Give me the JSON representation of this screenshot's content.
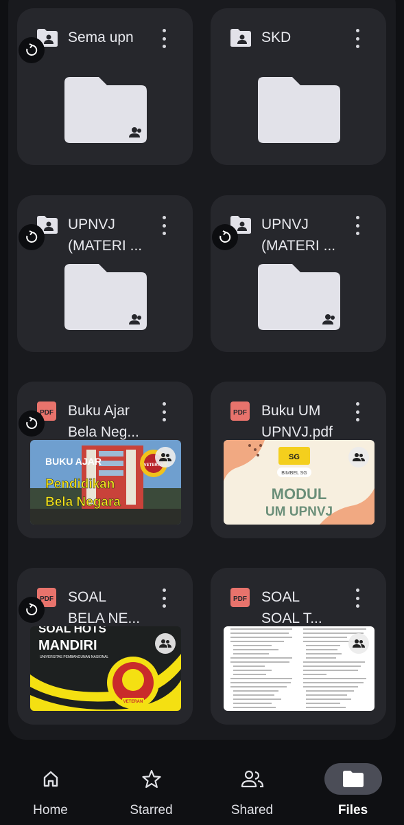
{
  "files": [
    {
      "title": "Sema upn",
      "kind": "folder",
      "synced": true
    },
    {
      "title": "SKD",
      "kind": "folder",
      "synced": false
    },
    {
      "title": "UPNVJ\n(MATERI ...",
      "kind": "folder",
      "synced": true
    },
    {
      "title": "UPNVJ\n(MATERI ...",
      "kind": "folder",
      "synced": true
    },
    {
      "title": "Buku Ajar\nBela Neg...",
      "kind": "pdf",
      "synced": true,
      "thumb": {
        "heading": "BUKU AJAR",
        "line1": "Pendidikan",
        "line2": "Bela Negara",
        "badge": "VETERAN"
      }
    },
    {
      "title": "Buku UM\nUPNVJ.pdf",
      "kind": "pdf",
      "synced": false,
      "thumb": {
        "logo": "SG",
        "brand": "BIMBEL SG",
        "line1": "MODUL",
        "line2": "UM UPNVJ"
      }
    },
    {
      "title": "SOAL\nBELA NE...",
      "kind": "pdf",
      "synced": true,
      "thumb": {
        "line1": "SOAL HOTS",
        "line2": "MANDIRI",
        "sub": "UNIVERSITAS PEMBANGUNAN NASIONAL",
        "badge": "VETERAN"
      }
    },
    {
      "title": "SOAL\nSOAL T...",
      "kind": "pdf",
      "synced": false,
      "thumb": {
        "kind": "document-page"
      }
    }
  ],
  "pdf_label": "PDF",
  "nav": [
    {
      "label": "Home",
      "icon": "home-icon"
    },
    {
      "label": "Starred",
      "icon": "star-icon"
    },
    {
      "label": "Shared",
      "icon": "people-icon"
    },
    {
      "label": "Files",
      "icon": "folder-icon",
      "active": true
    }
  ],
  "colors": {
    "background": "#0f1013",
    "card": "#26272c",
    "folder": "#e2e2e9",
    "pdf": "#e8736c",
    "active_pill": "#4b4d57"
  }
}
